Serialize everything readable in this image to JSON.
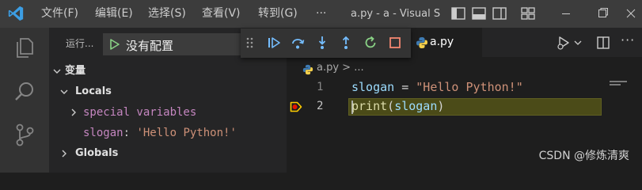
{
  "titlebar": {
    "menu": [
      "文件(F)",
      "编辑(E)",
      "选择(S)",
      "查看(V)",
      "转到(G)"
    ],
    "more": "···",
    "title": "a.py - a - Visual S"
  },
  "sidebar": {
    "run_label": "运行...",
    "config": "没有配置",
    "variables_header": "变量",
    "locals_label": "Locals",
    "special_vars": "special variables",
    "var_name": "slogan",
    "var_sep": ": ",
    "var_value": "'Hello Python!'",
    "globals_label": "Globals"
  },
  "tab": {
    "label": "a.py"
  },
  "editor": {
    "breadcrumb_file": "a.py",
    "breadcrumb_sep": " > ...",
    "lines": [
      {
        "num": "1",
        "var": "slogan",
        "op": " = ",
        "str": "\"Hello Python!\""
      },
      {
        "num": "2",
        "fn": "print",
        "open": "(",
        "arg": "slogan",
        "close": ")"
      }
    ]
  },
  "watermark": "CSDN @修炼清爽",
  "colors": {
    "accent_blue": "#75beff",
    "continue_green": "#89d185",
    "stop_red": "#f48771",
    "breakpoint_yellow": "#ffcc00",
    "python_blue": "#3e7bb3",
    "python_yellow": "#f5d04c"
  }
}
